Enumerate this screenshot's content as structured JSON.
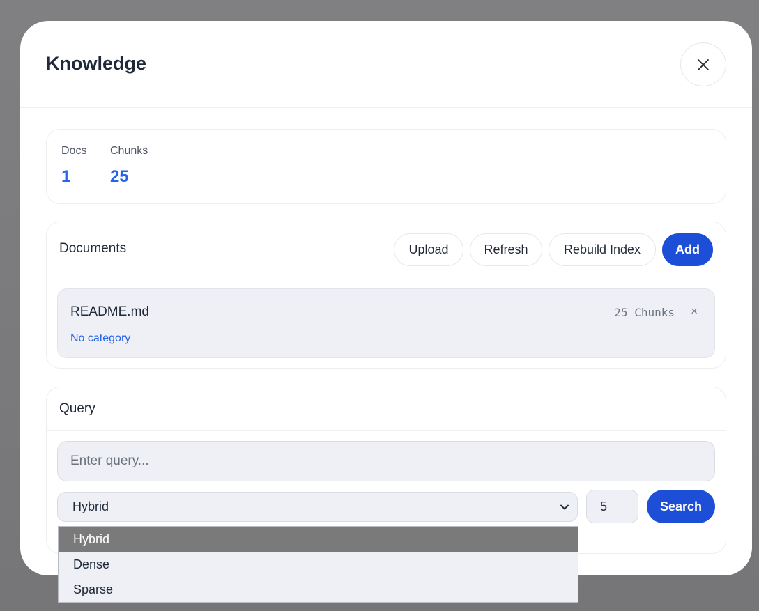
{
  "modal": {
    "title": "Knowledge",
    "close_icon": "close-icon"
  },
  "stats": {
    "docs_label": "Docs",
    "docs_value": "1",
    "chunks_label": "Chunks",
    "chunks_value": "25"
  },
  "documents": {
    "title": "Documents",
    "buttons": {
      "upload": "Upload",
      "refresh": "Refresh",
      "rebuild": "Rebuild Index",
      "add": "Add"
    },
    "items": [
      {
        "name": "README.md",
        "category": "No category",
        "chunks": "25 Chunks",
        "remove": "×"
      }
    ]
  },
  "query": {
    "title": "Query",
    "input_placeholder": "Enter query...",
    "mode_selected": "Hybrid",
    "mode_options": [
      "Hybrid",
      "Dense",
      "Sparse"
    ],
    "top_k": "5",
    "search_label": "Search"
  },
  "colors": {
    "accent": "#1d4ed8",
    "link": "#2563eb",
    "field_bg": "#eef0f5"
  }
}
